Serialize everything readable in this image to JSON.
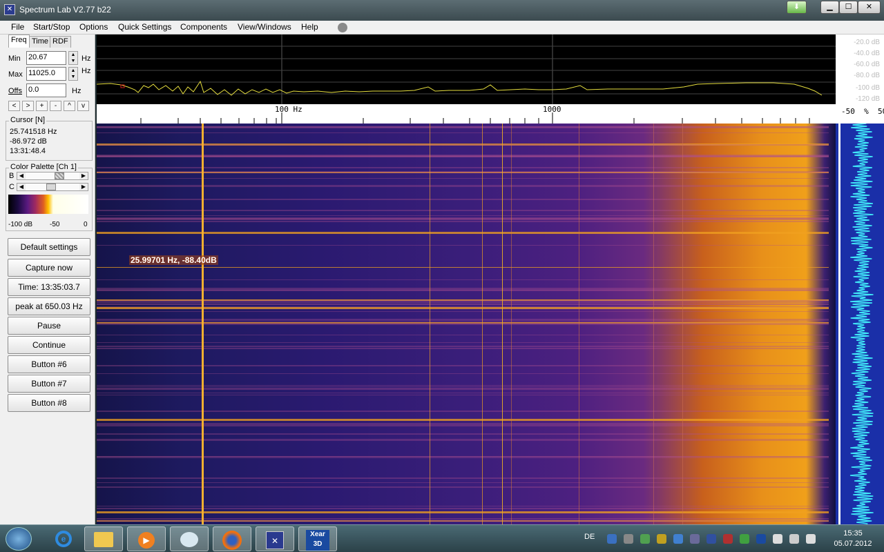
{
  "window": {
    "title": "Spectrum Lab V2.77 b22",
    "app_icon": "spectrum-lab-icon"
  },
  "menu": [
    {
      "label": "File"
    },
    {
      "label": "Start/Stop"
    },
    {
      "label": "Options"
    },
    {
      "label": "Quick Settings"
    },
    {
      "label": "Components"
    },
    {
      "label": "View/Windows"
    },
    {
      "label": "Help"
    }
  ],
  "tabs": [
    "Freq",
    "Time",
    "RDF"
  ],
  "freq": {
    "min_label": "Min",
    "min_value": "20.67",
    "min_unit": "Hz",
    "max_label": "Max",
    "max_value": "11025.0",
    "max_unit": "Hz",
    "offs_label": "Offs",
    "offs_value": "0.0",
    "offs_unit": "Hz",
    "nav_buttons": [
      "<",
      ">",
      "+",
      "-",
      "^",
      "v"
    ]
  },
  "cursor": {
    "title": "Cursor [N]",
    "freq": "25.741518 Hz",
    "level": "-86.972 dB",
    "time": "13:31:48.4"
  },
  "palette": {
    "title": "Color Palette [Ch 1]",
    "b_label": "B",
    "c_label": "C",
    "scale_min": "-100 dB",
    "scale_mid": "-50",
    "scale_max": "0"
  },
  "buttons": [
    "Default settings",
    "Capture now",
    "Time:  13:35:03.7",
    "peak at 650.03 Hz",
    "Pause",
    "Continue",
    "Button #6",
    "Button #7",
    "Button #8"
  ],
  "spectrum": {
    "db_labels": [
      "-20.0 dB",
      "-40.0 dB",
      "-60.0 dB",
      "-80.0 dB",
      "-100 dB",
      "-120 dB"
    ],
    "freq_labels": [
      "100 Hz",
      "1000"
    ],
    "right_scale": "-50  %  50"
  },
  "waterfall": {
    "cursor_readout": "25.99701 Hz, -88.40dB"
  },
  "taskbar": {
    "lang": "DE",
    "time": "15:35",
    "date": "05.07.2012",
    "items": [
      "start-orb-icon",
      "internet-explorer-icon",
      "explorer-icon",
      "media-player-icon",
      "mail-icon",
      "firefox-icon",
      "spectrum-lab-icon",
      "xear3d-icon"
    ]
  },
  "colors": {
    "accent_orange": "#f0a020",
    "waterfall_base": "#1a1850",
    "spectrum_trace": "#e8e040"
  }
}
